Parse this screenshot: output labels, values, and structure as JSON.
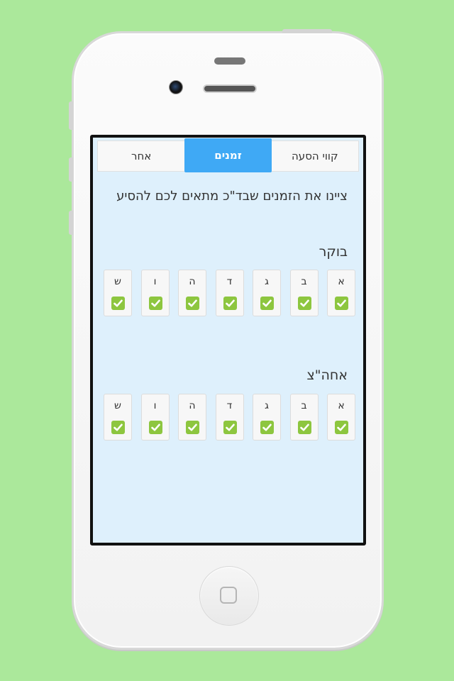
{
  "tabs": [
    {
      "label": "קווי הסעה",
      "active": false
    },
    {
      "label": "זמנים",
      "active": true
    },
    {
      "label": "אחר",
      "active": false
    }
  ],
  "title": "ציינו את הזמנים שבד\"כ מתאים לכם להסיע",
  "sections": [
    {
      "label": "בוקר",
      "days": [
        {
          "label": "א",
          "checked": true
        },
        {
          "label": "ב",
          "checked": true
        },
        {
          "label": "ג",
          "checked": true
        },
        {
          "label": "ד",
          "checked": true
        },
        {
          "label": "ה",
          "checked": true
        },
        {
          "label": "ו",
          "checked": true
        },
        {
          "label": "ש",
          "checked": true
        }
      ]
    },
    {
      "label": "אחה\"צ",
      "days": [
        {
          "label": "א",
          "checked": true
        },
        {
          "label": "ב",
          "checked": true
        },
        {
          "label": "ג",
          "checked": true
        },
        {
          "label": "ד",
          "checked": true
        },
        {
          "label": "ה",
          "checked": true
        },
        {
          "label": "ו",
          "checked": true
        },
        {
          "label": "ש",
          "checked": true
        }
      ]
    }
  ],
  "icons": {
    "check": "checkmark-icon",
    "home": "home-button-icon"
  },
  "colors": {
    "background": "#abe89b",
    "accent": "#3fa9f5",
    "check": "#8dc63f",
    "screen": "#def0fc"
  }
}
